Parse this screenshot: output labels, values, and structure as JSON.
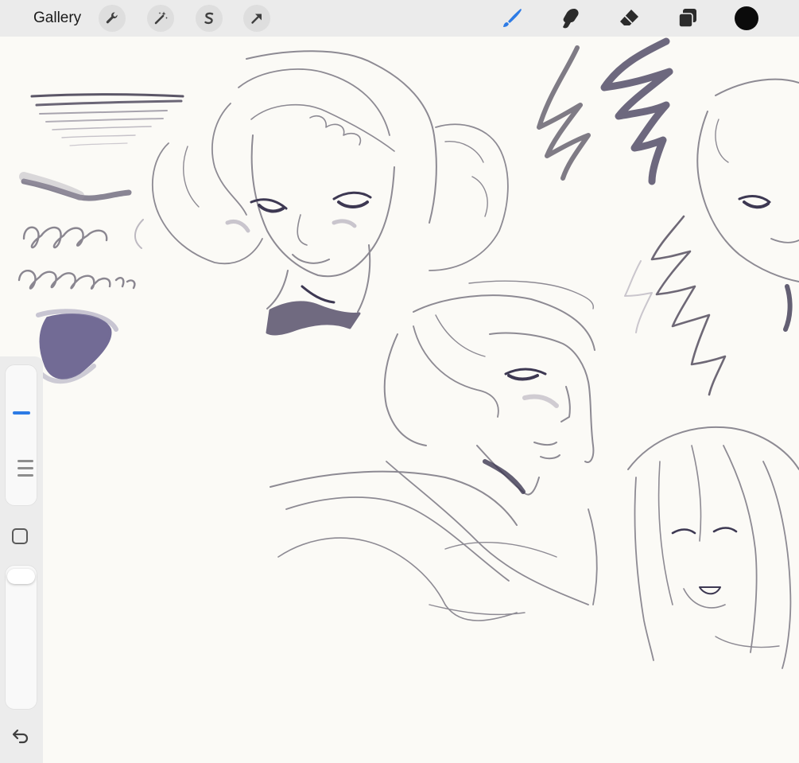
{
  "toolbar": {
    "gallery_label": "Gallery",
    "left_tools": [
      "wrench-icon",
      "magic-wand-icon",
      "selection-icon",
      "transform-arrow-icon"
    ],
    "right_tools": [
      "brush-icon",
      "smudge-icon",
      "eraser-icon",
      "layers-icon"
    ],
    "active_tool": "brush",
    "active_color": "#0b0b0b",
    "accent_color": "#2d7be5"
  },
  "sidebar": {
    "brush_size": 0.72,
    "brush_opacity": 0.98
  }
}
